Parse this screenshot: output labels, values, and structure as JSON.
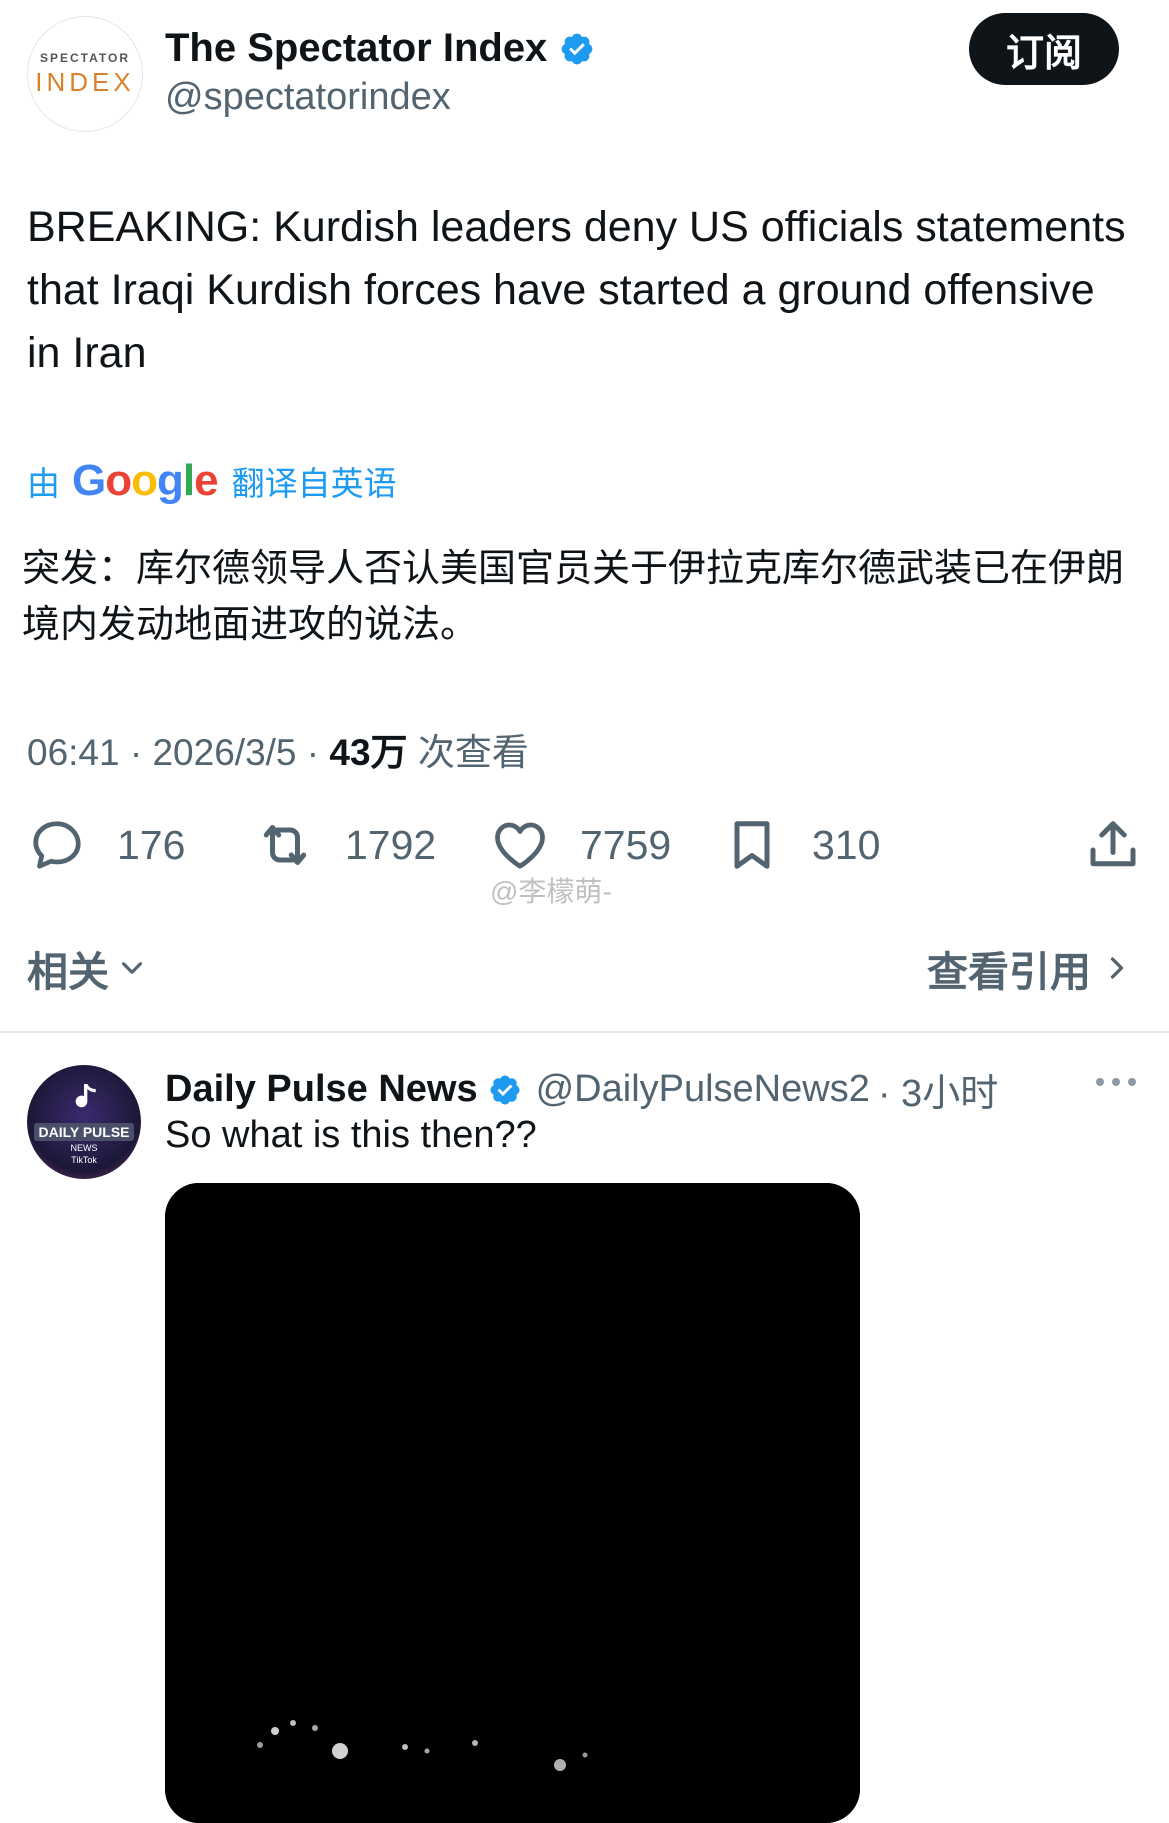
{
  "post": {
    "author": {
      "avatar_text_top": "SPECTATOR",
      "avatar_text_bottom": "INDEX",
      "name": "The Spectator Index",
      "handle": "@spectatorindex",
      "verified_icon": "verified-badge-icon"
    },
    "subscribe_label": "订阅",
    "text": "BREAKING: Kurdish leaders deny US officials statements that Iraqi Kurdish forces have started a ground offensive in Iran",
    "translation": {
      "prefix": "由",
      "provider": "Google",
      "suffix": "翻译自英语",
      "text": "突发：库尔德领导人否认美国官员关于伊拉克库尔德武装已在伊朗境内发动地面进攻的说法。"
    },
    "meta": {
      "time": "06:41",
      "date": "2026/3/5",
      "views": "43万",
      "views_label": "次查看"
    },
    "actions": {
      "replies": "176",
      "reposts": "1792",
      "likes": "7759",
      "bookmarks": "310"
    },
    "related_label": "相关",
    "view_quotes_label": "查看引用"
  },
  "watermark": "@李檬萌-",
  "reply": {
    "avatar_text": "DAILY PULSE",
    "avatar_subtext": "NEWS",
    "avatar_sub2": "TikTok",
    "name": "Daily Pulse News",
    "handle": "@DailyPulseNews2",
    "time": "· 3小时",
    "text": "So what is this then??"
  },
  "colors": {
    "accent": "#1d9bf0",
    "text": "#0f1419",
    "secondary": "#536471",
    "divider": "#e7e9ea"
  }
}
